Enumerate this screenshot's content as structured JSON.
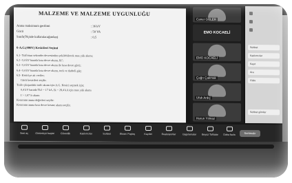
{
  "document": {
    "title": "MALZEME VE MALZEME UYGUNLUĞU",
    "specs": [
      {
        "label": "Anma maksimum gerilimi",
        "value": ": 36 kV"
      },
      {
        "label": "Gücü",
        "value": ": 50 VA"
      },
      {
        "label": "Sınıfı(Ölçüde kullanılacağından)",
        "value": ": 0,5"
      }
    ],
    "section_heading": "6-A.G.(400V) Kesicileri Seçimi",
    "lines": [
      "6.1- Trafonun sekonder devresinden çekilebilecek max yük akımı;",
      "6.2- 0,4 kV barada kısa devre akımı, Ik'';",
      "6.3- 0,4 kV barada kısa devre akımı ile kısa devre gücü;",
      "6.4- 0,4 kV barada kısa devre akımı, tork ve darbeli güç;",
      "6.5- Kesiciye ait veriler;",
      "Gücü kesicileri seçilir.",
      "Trafo çıkışındaki trafo akımı için A.G. Kesici seçmek için;",
      "0,4 kV barada Tk3 ~ 17 kA, Ik ~ 28,4 kA için max yük akımı",
      "I > 1,67 Ir akımı",
      "Kesicinin anma değerleri seçilir:",
      "Kesicinin anma kısa devre kesme akımı seçilir."
    ]
  },
  "participants": [
    {
      "name": "Caner GÜLER"
    },
    {
      "name": "EMO KOCAELİ",
      "is_org": true
    },
    {
      "name": "EMO KOCAELİ"
    },
    {
      "name": "Çağrı Çakmak"
    },
    {
      "name": "Ufuk Ardıç"
    },
    {
      "name": "Harun Yılmaz"
    }
  ],
  "side_panel": {
    "buttons": [
      "Sohbet",
      "Katılımcılar",
      "Kayıt",
      "Ara",
      "Gizle"
    ],
    "bottom_button": "Sohbet gönder"
  },
  "toolbar": {
    "items": [
      {
        "label": "Sesi aç",
        "icon": "microphone-icon"
      },
      {
        "label": "Görüntüyü başlat",
        "icon": "video-icon"
      },
      {
        "label": "Güvenlik",
        "icon": "shield-icon"
      },
      {
        "label": "Katılımcılar",
        "icon": "people-icon"
      },
      {
        "label": "Sohbet",
        "icon": "chat-icon"
      },
      {
        "label": "Ekranı Paylaş",
        "icon": "share-icon"
      },
      {
        "label": "Kaydet",
        "icon": "record-icon"
      },
      {
        "label": "Reaksiyonlar",
        "icon": "smile-icon"
      },
      {
        "label": "Uygulamalar",
        "icon": "apps-icon"
      },
      {
        "label": "Beyaz Tahtalar",
        "icon": "whiteboard-icon"
      },
      {
        "label": "Daha fazla",
        "icon": "more-icon"
      }
    ],
    "end_label": "Sonlandır"
  }
}
